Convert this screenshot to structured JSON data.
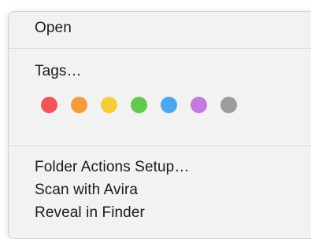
{
  "menu": {
    "open_label": "Open",
    "tags_label": "Tags…",
    "tag_colors": [
      {
        "name": "red",
        "color": "#f2545b"
      },
      {
        "name": "orange",
        "color": "#f49b3b"
      },
      {
        "name": "yellow",
        "color": "#f4cd3a"
      },
      {
        "name": "green",
        "color": "#63c94e"
      },
      {
        "name": "blue",
        "color": "#4aa8ec"
      },
      {
        "name": "purple",
        "color": "#c57ae0"
      },
      {
        "name": "gray",
        "color": "#9c9c9c"
      }
    ],
    "folder_actions_label": "Folder Actions Setup…",
    "scan_label": "Scan with Avira",
    "reveal_label": "Reveal in Finder"
  }
}
